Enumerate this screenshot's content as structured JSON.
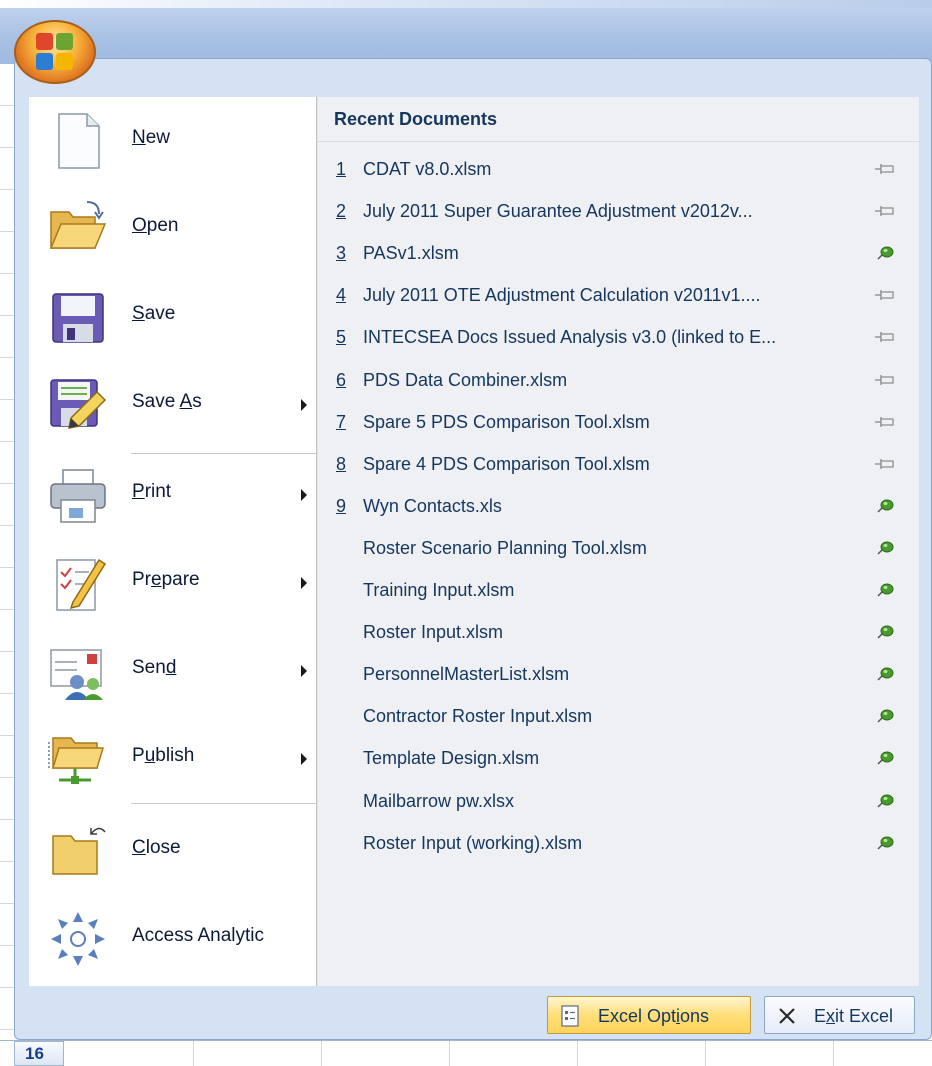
{
  "menu": {
    "commands": [
      {
        "pre": "",
        "key": "N",
        "post": "ew",
        "icon": "new-document-icon",
        "has_submenu": false
      },
      {
        "pre": "",
        "key": "O",
        "post": "pen",
        "icon": "open-folder-icon",
        "has_submenu": false
      },
      {
        "pre": "",
        "key": "S",
        "post": "ave",
        "icon": "save-disk-icon",
        "has_submenu": false
      },
      {
        "pre": "Save ",
        "key": "A",
        "post": "s",
        "icon": "save-as-icon",
        "has_submenu": true
      },
      {
        "pre": "",
        "key": "P",
        "post": "rint",
        "icon": "printer-icon",
        "has_submenu": true
      },
      {
        "pre": "Pr",
        "key": "e",
        "post": "pare",
        "icon": "prepare-icon",
        "has_submenu": true
      },
      {
        "pre": "Sen",
        "key": "d",
        "post": "",
        "icon": "send-icon",
        "has_submenu": true
      },
      {
        "pre": "P",
        "key": "u",
        "post": "blish",
        "icon": "publish-icon",
        "has_submenu": true
      },
      {
        "pre": "",
        "key": "C",
        "post": "lose",
        "icon": "close-folder-icon",
        "has_submenu": false
      },
      {
        "pre": "Access Analytic",
        "key": "",
        "post": "",
        "icon": "access-analytic-icon",
        "has_submenu": false
      }
    ]
  },
  "recent": {
    "title": "Recent Documents",
    "documents": [
      {
        "num": "1",
        "name": "CDAT v8.0.xlsm",
        "pinned": false
      },
      {
        "num": "2",
        "name": "July 2011 Super Guarantee Adjustment v2012v...",
        "pinned": false
      },
      {
        "num": "3",
        "name": "PASv1.xlsm",
        "pinned": true
      },
      {
        "num": "4",
        "name": "July 2011 OTE Adjustment Calculation v2011v1....",
        "pinned": false
      },
      {
        "num": "5",
        "name": "INTECSEA Docs Issued Analysis v3.0 (linked to E...",
        "pinned": false
      },
      {
        "num": "6",
        "name": "PDS Data Combiner.xlsm",
        "pinned": false
      },
      {
        "num": "7",
        "name": "Spare 5 PDS Comparison Tool.xlsm",
        "pinned": false
      },
      {
        "num": "8",
        "name": "Spare 4 PDS Comparison Tool.xlsm",
        "pinned": false
      },
      {
        "num": "9",
        "name": "Wyn Contacts.xls",
        "pinned": true
      },
      {
        "num": "",
        "name": "Roster Scenario Planning Tool.xlsm",
        "pinned": true
      },
      {
        "num": "",
        "name": "Training Input.xlsm",
        "pinned": true
      },
      {
        "num": "",
        "name": "Roster Input.xlsm",
        "pinned": true
      },
      {
        "num": "",
        "name": "PersonnelMasterList.xlsm",
        "pinned": true
      },
      {
        "num": "",
        "name": "Contractor Roster Input.xlsm",
        "pinned": true
      },
      {
        "num": "",
        "name": "Template Design.xlsm",
        "pinned": true
      },
      {
        "num": "",
        "name": "Mailbarrow pw.xlsx",
        "pinned": true
      },
      {
        "num": "",
        "name": "Roster Input (working).xlsm",
        "pinned": true
      }
    ]
  },
  "buttons": {
    "options": {
      "pre": "Excel Opt",
      "key": "i",
      "post": "ons"
    },
    "exit": {
      "pre": "E",
      "key": "x",
      "post": "it Excel"
    }
  },
  "sheet": {
    "row_number": "16"
  },
  "colors": {
    "accent": "#15365e",
    "menu_frame": "#d5e2f3",
    "pin_green": "#4a9b2f"
  }
}
